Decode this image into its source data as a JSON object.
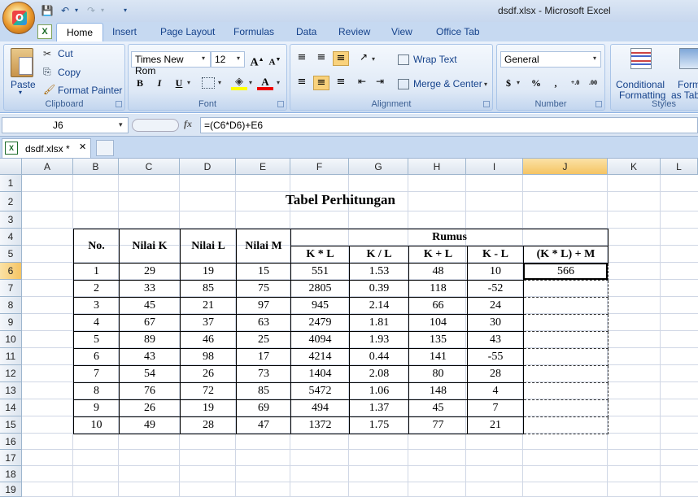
{
  "window": {
    "title": "dsdf.xlsx - Microsoft Excel"
  },
  "ribbon": {
    "tabs": [
      "Home",
      "Insert",
      "Page Layout",
      "Formulas",
      "Data",
      "Review",
      "View",
      "Office Tab"
    ],
    "clipboard": {
      "paste": "Paste",
      "cut": "Cut",
      "copy": "Copy",
      "format_painter": "Format Painter",
      "label": "Clipboard"
    },
    "font": {
      "name": "Times New Rom",
      "size": "12",
      "label": "Font"
    },
    "alignment": {
      "wrap": "Wrap Text",
      "merge": "Merge & Center",
      "label": "Alignment"
    },
    "number": {
      "format": "General",
      "label": "Number",
      "currency": "$",
      "percent": "%",
      "comma": ","
    },
    "styles": {
      "conditional": "Conditional",
      "formatting": "Formatting",
      "format_as": "Form",
      "table": "as Tab",
      "label": "Styles"
    }
  },
  "formula_bar": {
    "cell": "J6",
    "fx": "fx",
    "formula": "=(C6*D6)+E6"
  },
  "doc_tab": {
    "name": "dsdf.xlsx *",
    "close": "✕"
  },
  "columns": [
    "A",
    "B",
    "C",
    "D",
    "E",
    "F",
    "G",
    "H",
    "I",
    "J",
    "K",
    "L"
  ],
  "rows": [
    "1",
    "2",
    "3",
    "4",
    "5",
    "6",
    "7",
    "8",
    "9",
    "10",
    "11",
    "12",
    "13",
    "14",
    "15",
    "16",
    "17",
    "18",
    "19"
  ],
  "sheet": {
    "title": "Tabel Perhitungan",
    "headers": {
      "no": "No.",
      "k": "Nilai K",
      "l": "Nilai L",
      "m": "Nilai M",
      "rumus": "Rumus"
    },
    "sub_headers": [
      "K * L",
      "K / L",
      "K + L",
      "K - L",
      "(K * L) + M"
    ],
    "data": [
      [
        "1",
        "29",
        "19",
        "15",
        "551",
        "1.53",
        "48",
        "10",
        "566"
      ],
      [
        "2",
        "33",
        "85",
        "75",
        "2805",
        "0.39",
        "118",
        "-52",
        ""
      ],
      [
        "3",
        "45",
        "21",
        "97",
        "945",
        "2.14",
        "66",
        "24",
        ""
      ],
      [
        "4",
        "67",
        "37",
        "63",
        "2479",
        "1.81",
        "104",
        "30",
        ""
      ],
      [
        "5",
        "89",
        "46",
        "25",
        "4094",
        "1.93",
        "135",
        "43",
        ""
      ],
      [
        "6",
        "43",
        "98",
        "17",
        "4214",
        "0.44",
        "141",
        "-55",
        ""
      ],
      [
        "7",
        "54",
        "26",
        "73",
        "1404",
        "2.08",
        "80",
        "28",
        ""
      ],
      [
        "8",
        "76",
        "72",
        "85",
        "5472",
        "1.06",
        "148",
        "4",
        ""
      ],
      [
        "9",
        "26",
        "19",
        "69",
        "494",
        "1.37",
        "45",
        "7",
        ""
      ],
      [
        "10",
        "49",
        "28",
        "47",
        "1372",
        "1.75",
        "77",
        "21",
        ""
      ]
    ]
  }
}
